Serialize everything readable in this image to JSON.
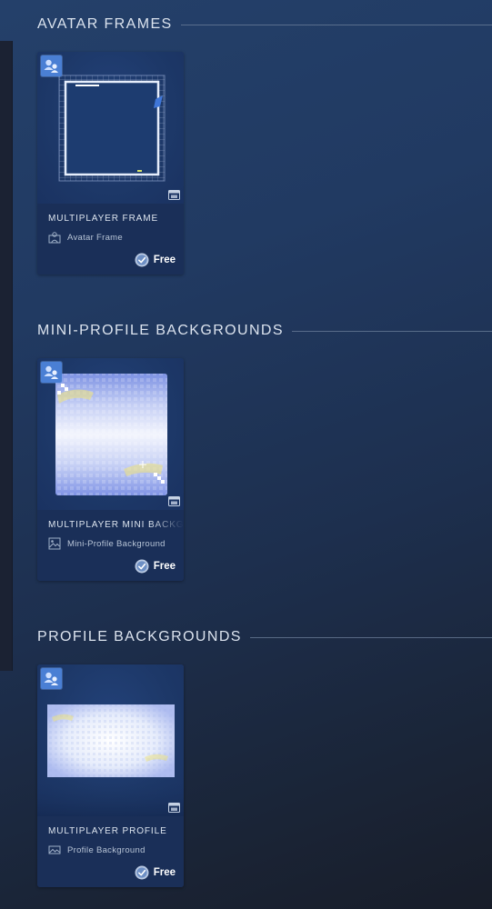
{
  "sections": [
    {
      "title": "AVATAR FRAMES",
      "item": {
        "name": "MULTIPLAYER FRAME",
        "type": "Avatar Frame",
        "type_icon": "avatar-frame-icon",
        "price": "Free",
        "badge_icon": "multiplayer-icon",
        "animated_icon": "animated-film-icon"
      }
    },
    {
      "title": "MINI-PROFILE BACKGROUNDS",
      "item": {
        "name": "MULTIPLAYER MINI BACKGROUND",
        "type": "Mini-Profile Background",
        "type_icon": "image-icon",
        "price": "Free",
        "badge_icon": "multiplayer-icon",
        "animated_icon": "animated-film-icon"
      }
    },
    {
      "title": "PROFILE BACKGROUNDS",
      "item": {
        "name": "MULTIPLAYER PROFILE",
        "type": "Profile Background",
        "type_icon": "landscape-image-icon",
        "price": "Free",
        "badge_icon": "multiplayer-icon",
        "animated_icon": "animated-film-icon"
      }
    }
  ],
  "colors": {
    "accent_badge": "#4a7fd4",
    "card_bg": "#1c3562",
    "card_info_bg": "#1a2f58"
  }
}
